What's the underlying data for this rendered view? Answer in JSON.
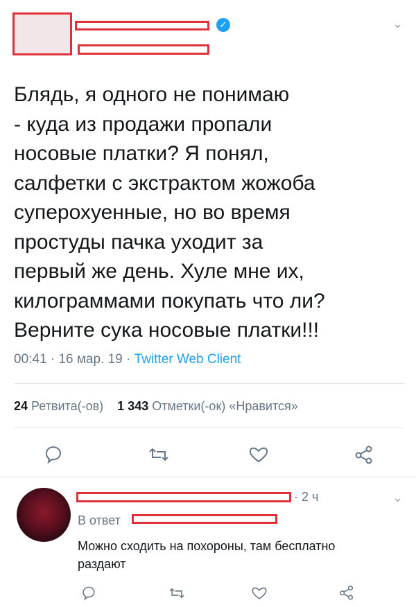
{
  "tweet": {
    "text": "Блядь, я одного не понимаю\n- куда из продажи пропали\nносовые платки? Я понял,\nсалфетки с экстрактом жожоба\nсуперохуенные, но во время\nпростуды пачка уходит за\nпервый же день. Хуле мне их,\nкилограммами покупать что ли?\nВерните сука носовые платки!!!",
    "time": "00:41",
    "date": "16 мар. 19",
    "separator": " · ",
    "client": "Twitter Web Client",
    "retweets_count": "24",
    "retweets_label": "Ретвита(-ов)",
    "likes_count": "1 343",
    "likes_label": "Отметки(-ок) «Нравится»"
  },
  "reply": {
    "time": "· 2 ч",
    "reply_to_prefix": "В ответ",
    "text": "Можно сходить на похороны, там бесплатно раздают"
  },
  "icons": {
    "reply": "reply-icon",
    "retweet": "retweet-icon",
    "like": "heart-icon",
    "share": "share-icon",
    "menu": "chevron-down-icon",
    "verified": "verified-badge-icon"
  },
  "colors": {
    "accent": "#1da1f2",
    "secondary_text": "#657786",
    "redaction": "#e0303a"
  }
}
